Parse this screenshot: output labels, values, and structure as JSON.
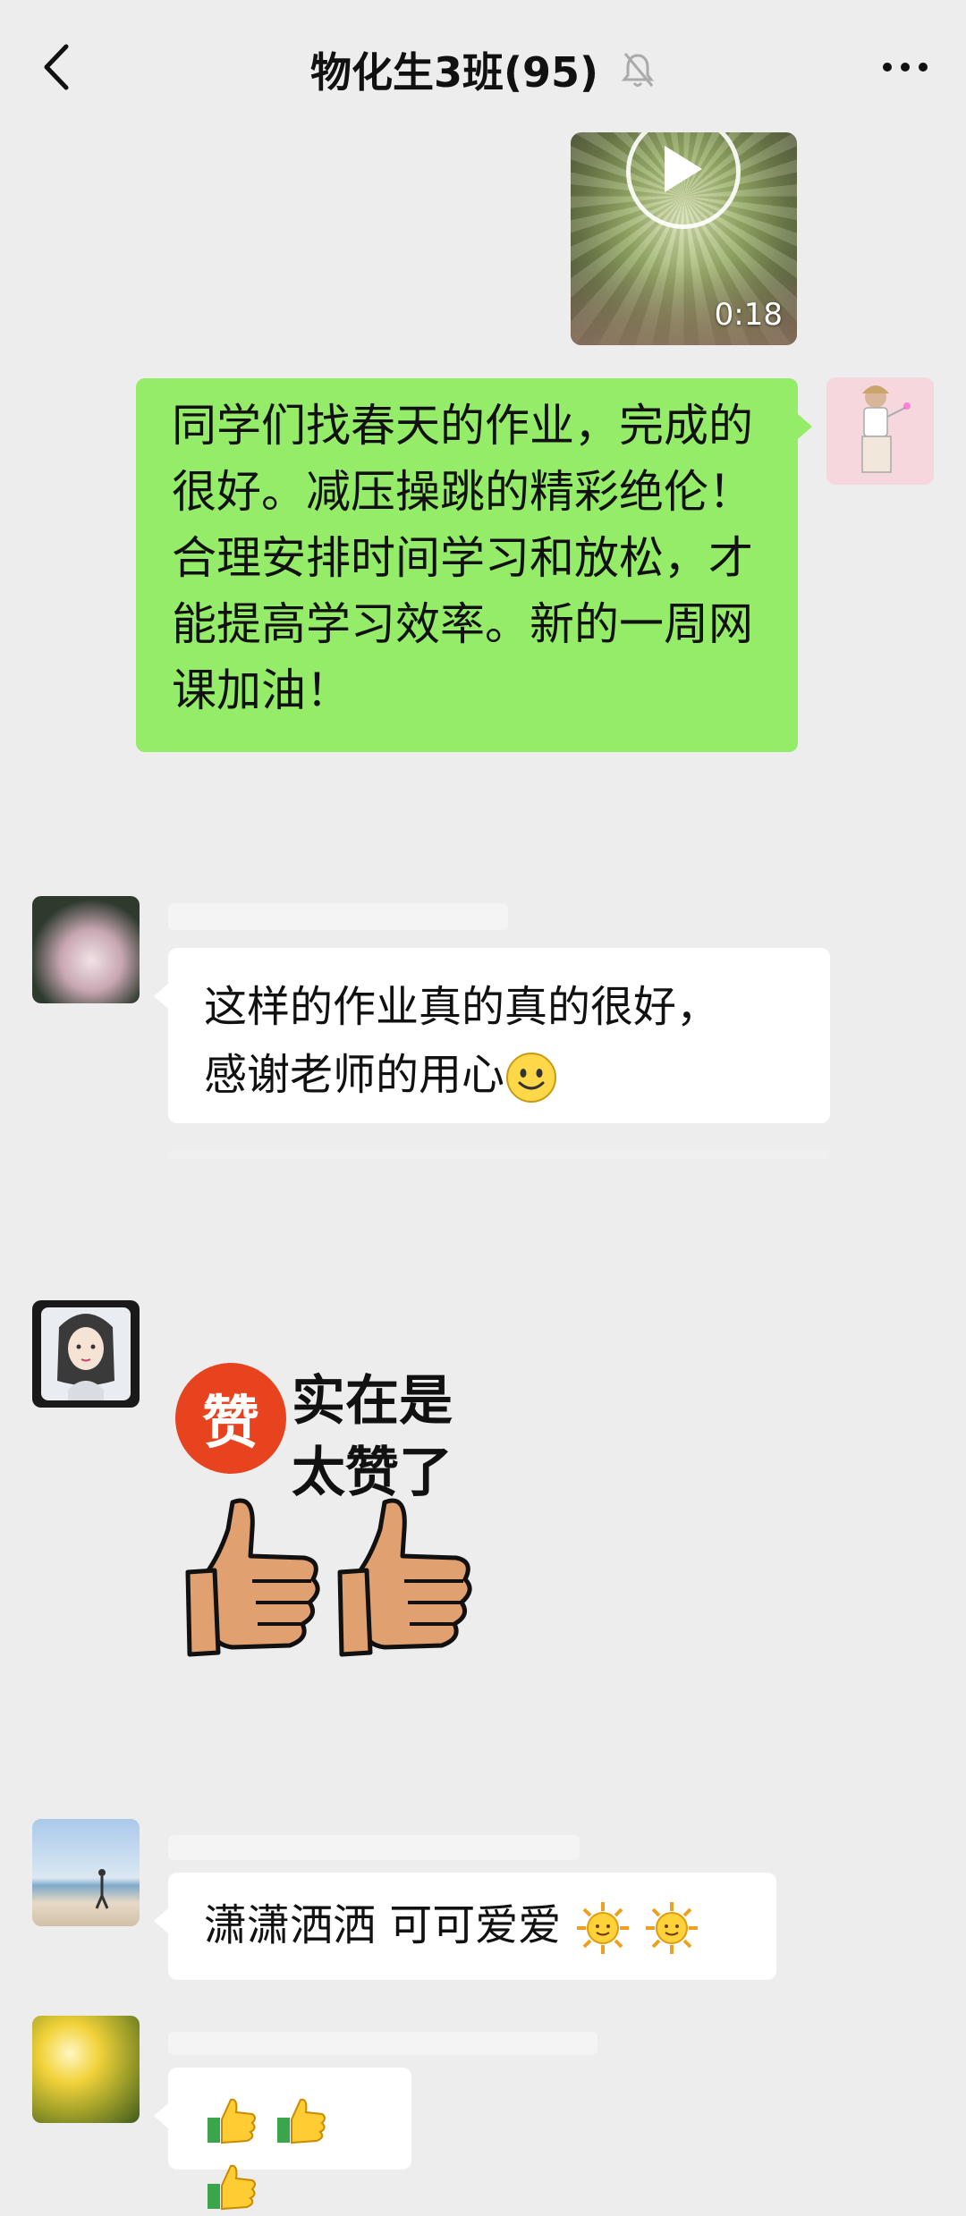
{
  "header": {
    "title": "物化生3班(95)",
    "back_icon": "chevron-left-icon",
    "mute_icon": "bell-off-icon",
    "more_icon": "ellipsis-icon"
  },
  "messages": [
    {
      "type": "video",
      "sender": "self",
      "duration": "0:18"
    },
    {
      "type": "text",
      "sender": "self",
      "text": "同学们找春天的作业，完成的很好。减压操跳的精彩绝伦！合理安排时间学习和放松，才能提高学习效率。新的一周网课加油！"
    },
    {
      "type": "text",
      "sender": "other",
      "lines": [
        "这样的作业真的真的很好，",
        "感谢老师的用心"
      ],
      "emoji": "smile-emoji"
    },
    {
      "type": "sticker",
      "sender": "other",
      "badge": "赞",
      "line1": "实在是",
      "line2": "太赞了"
    },
    {
      "type": "text",
      "sender": "other",
      "text": "潇潇洒洒 可可爱爱",
      "emoji": "sun-emoji"
    },
    {
      "type": "text",
      "sender": "other",
      "emoji": "thumbs-up-emoji"
    }
  ],
  "colors": {
    "background": "#ededed",
    "self_bubble": "#95ec69",
    "other_bubble": "#ffffff"
  }
}
